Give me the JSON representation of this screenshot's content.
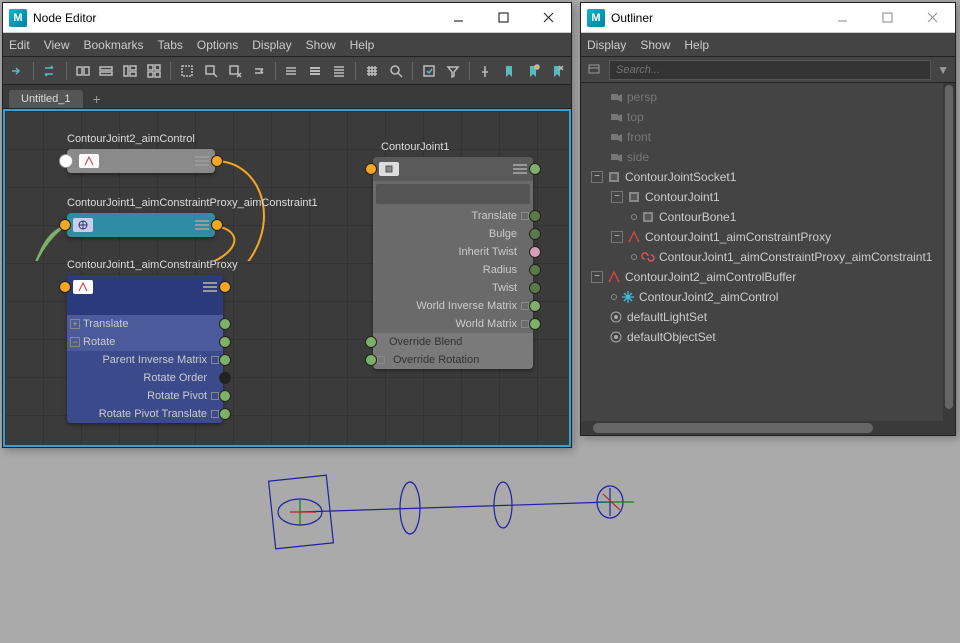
{
  "nodeEditor": {
    "title": "Node Editor",
    "menus": [
      "Edit",
      "View",
      "Bookmarks",
      "Tabs",
      "Options",
      "Display",
      "Show",
      "Help"
    ],
    "tab": "Untitled_1",
    "nodes": {
      "aimControl": {
        "label": "ContourJoint2_aimControl"
      },
      "aimConstraint": {
        "label": "ContourJoint1_aimConstraintProxy_aimConstraint1"
      },
      "proxy": {
        "label": "ContourJoint1_aimConstraintProxy",
        "attrs_top": [
          "Translate",
          "Rotate"
        ],
        "attrs_sub": [
          "Parent Inverse Matrix",
          "Rotate Order",
          "Rotate Pivot",
          "Rotate Pivot Translate"
        ]
      },
      "contourJoint": {
        "label": "ContourJoint1",
        "attrs": [
          "Translate",
          "Bulge",
          "Inherit Twist",
          "Radius",
          "Twist",
          "World Inverse Matrix",
          "World Matrix",
          "Override Blend",
          "Override Rotation"
        ]
      }
    }
  },
  "outliner": {
    "title": "Outliner",
    "menus": [
      "Display",
      "Show",
      "Help"
    ],
    "search_placeholder": "Search...",
    "cameras": [
      "persp",
      "top",
      "front",
      "side"
    ],
    "tree": {
      "socket": "ContourJointSocket1",
      "joint1": "ContourJoint1",
      "bone1": "ContourBone1",
      "proxy": "ContourJoint1_aimConstraintProxy",
      "constraint": "ContourJoint1_aimConstraintProxy_aimConstraint1",
      "buffer": "ContourJoint2_aimControlBuffer",
      "control": "ContourJoint2_aimControl",
      "lightset": "defaultLightSet",
      "objectset": "defaultObjectSet"
    }
  }
}
